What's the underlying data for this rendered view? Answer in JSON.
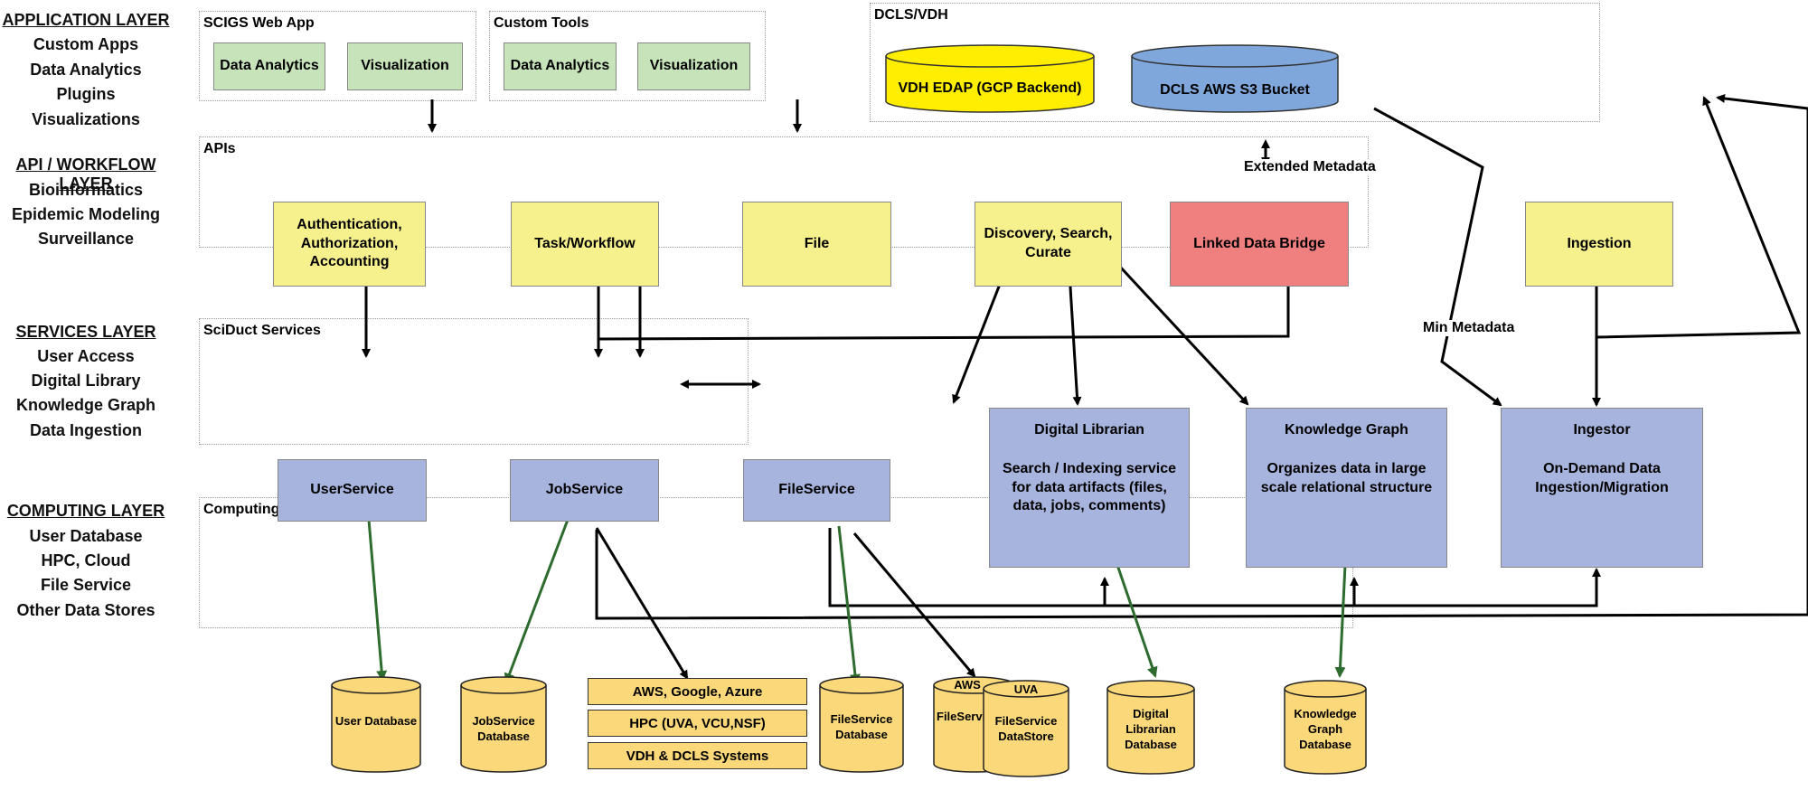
{
  "layers": [
    {
      "title": "APPLICATION LAYER",
      "items": [
        "Custom Apps",
        "Data Analytics",
        "Plugins",
        "Visualizations"
      ]
    },
    {
      "title": "API / WORKFLOW LAYER",
      "items": [
        "Bioinformatics",
        "Epidemic Modeling",
        "Surveillance"
      ]
    },
    {
      "title": "SERVICES LAYER",
      "items": [
        "User Access",
        "Digital Library",
        "Knowledge Graph",
        "Data Ingestion"
      ]
    },
    {
      "title": "COMPUTING LAYER",
      "items": [
        "User Database",
        "HPC, Cloud",
        "File Service",
        "Other Data Stores"
      ]
    }
  ],
  "containers": {
    "scigs": "SCIGS Web App",
    "custom": "Custom Tools",
    "dcls": "DCLS/VDH",
    "apis": "APIs",
    "sciduct": "SciDuct Services",
    "computing": "Computing Infrastructure"
  },
  "app": {
    "scigs": [
      "Data Analytics",
      "Visualization"
    ],
    "custom": [
      "Data Analytics",
      "Visualization"
    ]
  },
  "dcls": {
    "vdh": "VDH EDAP (GCP Backend)",
    "s3": "DCLS AWS S3 Bucket"
  },
  "apis": {
    "auth": "Authentication, Authorization, Accounting",
    "task": "Task/Workflow",
    "file": "File",
    "discovery": "Discovery, Search, Curate",
    "linked": "Linked Data Bridge",
    "ingestion": "Ingestion"
  },
  "labels": {
    "extended": "Extended Metadata",
    "min": "Min Metadata"
  },
  "services": {
    "user": "UserService",
    "job": "JobService",
    "file": "FileService",
    "dl": {
      "title": "Digital Librarian",
      "desc": "Search / Indexing service for data artifacts (files, data, jobs, comments)"
    },
    "kg": {
      "title": "Knowledge Graph",
      "desc": "Organizes data in large scale relational structure"
    },
    "ing": {
      "title": "Ingestor",
      "desc": "On-Demand Data Ingestion/Migration"
    }
  },
  "computing": {
    "userdb": "User Database",
    "jobdb": "JobService Database",
    "infra": [
      "AWS, Google, Azure",
      "HPC (UVA, VCU,NSF)",
      "VDH & DCLS Systems"
    ],
    "filedb": "FileService Database",
    "aws_tag": "AWS",
    "aws_ds": "FileService DataStore",
    "uva_tag": "UVA",
    "uva_ds": "FileService DataStore",
    "dldb": "Digital Librarian Database",
    "kgdb": "Knowledge Graph Database"
  },
  "colors": {
    "app": "#c6e3b9",
    "api": "#f6f18c",
    "linked": "#f07f7f",
    "service": "#a7b4dd",
    "db": "#fbd97a",
    "vdh": "#ffee00",
    "s3": "#7fa7dc",
    "green_arrow": "#2e6b2e"
  }
}
